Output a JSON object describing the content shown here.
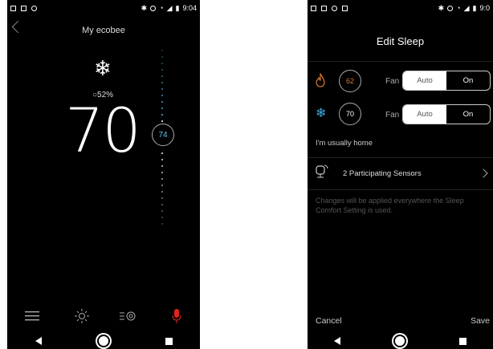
{
  "phone1": {
    "status": {
      "time": "9:04"
    },
    "title": "My ecobee",
    "humidity": "○52%",
    "current_temp": "70",
    "setpoint": "74",
    "toolbar": {
      "menu_icon": "menu-icon",
      "weather_icon": "sun-icon",
      "settings_icon": "settings-icon",
      "alexa_icon": "microphone-icon"
    },
    "colors": {
      "setpoint": "#5bc2e7",
      "mic": "#e0261b"
    }
  },
  "phone2": {
    "status": {
      "time": "9:0"
    },
    "title": "Edit Sleep",
    "heat": {
      "setpoint": "62",
      "fan_label": "Fan",
      "auto": "Auto",
      "on": "On"
    },
    "cool": {
      "setpoint": "70",
      "fan_label": "Fan",
      "auto": "Auto",
      "on": "On"
    },
    "usually_home": "I'm usually home",
    "sensors": "2 Participating Sensors",
    "note": "Changes will be applied everywhere the Sleep Comfort Setting is used.",
    "cancel": "Cancel",
    "save": "Save",
    "colors": {
      "heat": "#d9772b",
      "cool": "#3fa8e0"
    }
  }
}
